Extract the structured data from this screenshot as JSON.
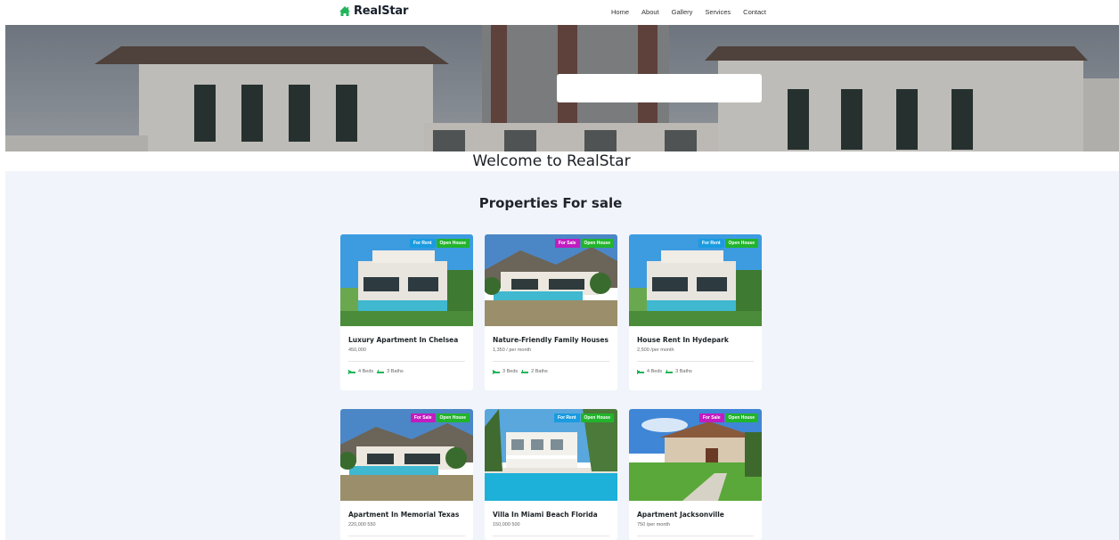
{
  "brand": {
    "name": "RealStar",
    "color": "#17202a",
    "icon_color": "#22b45a"
  },
  "nav": [
    {
      "label": "Home"
    },
    {
      "label": "About"
    },
    {
      "label": "Gallery"
    },
    {
      "label": "Services"
    },
    {
      "label": "Contact"
    }
  ],
  "hero": {
    "search_placeholder": ""
  },
  "welcome": "Welcome to RealStar",
  "section_title": "Properties For sale",
  "colors": {
    "rent": "#1a9be0",
    "sale": "#c21cc0",
    "open": "#22b42c",
    "accent": "#22b45a"
  },
  "properties": [
    {
      "badge1": "For Rent",
      "badge1_type": "rent",
      "badge2": "Open House",
      "title": "Luxury Apartment In Chelsea",
      "price": "450,000",
      "beds": "4 Beds",
      "baths": "3 Baths"
    },
    {
      "badge1": "For Sale",
      "badge1_type": "sale",
      "badge2": "Open House",
      "title": "Nature-Friendly Family Houses",
      "price": "1,350 / per month",
      "beds": "3 Beds",
      "baths": "2 Baths"
    },
    {
      "badge1": "For Rent",
      "badge1_type": "rent",
      "badge2": "Open House",
      "title": "House Rent In Hydepark",
      "price": "2,500 /per month",
      "beds": "4 Beds",
      "baths": "3 Baths"
    },
    {
      "badge1": "For Sale",
      "badge1_type": "sale",
      "badge2": "Open House",
      "title": "Apartment In Memorial Texas",
      "price": "220,000 550",
      "beds": "",
      "baths": ""
    },
    {
      "badge1": "For Rent",
      "badge1_type": "rent",
      "badge2": "Open House",
      "title": "Villa In Miami Beach Florida",
      "price": "150,000 500",
      "beds": "",
      "baths": ""
    },
    {
      "badge1": "For Sale",
      "badge1_type": "sale",
      "badge2": "Open House",
      "title": "Apartment Jacksonville",
      "price": "750 /per month",
      "beds": "",
      "baths": ""
    }
  ]
}
